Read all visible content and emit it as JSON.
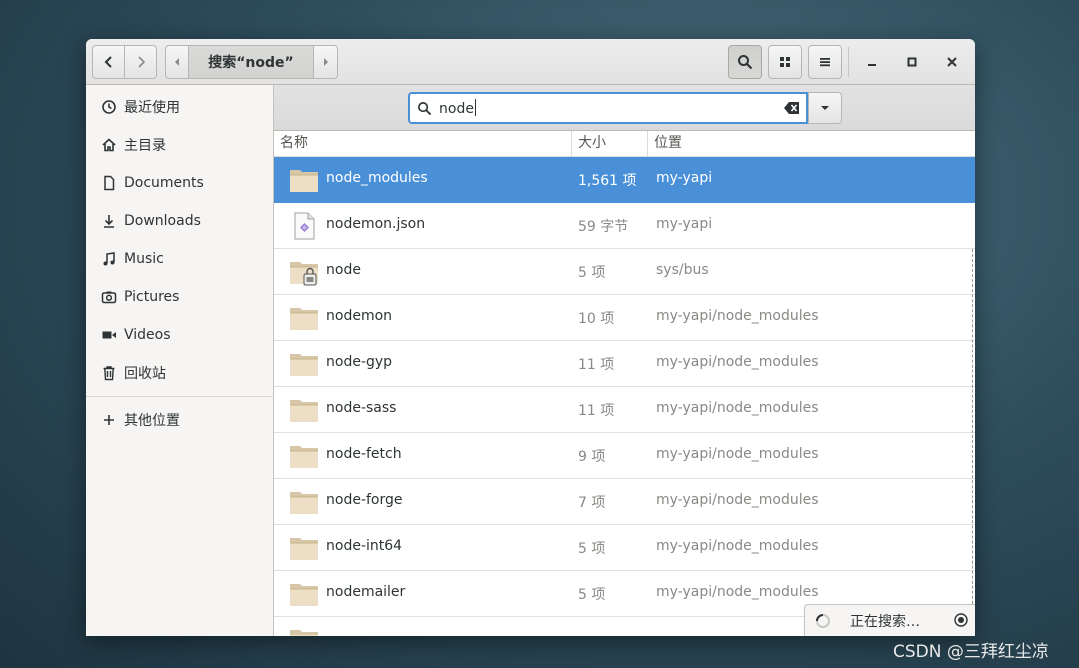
{
  "header": {
    "path_label": "搜索“node”"
  },
  "sidebar": {
    "items": [
      {
        "label": "最近使用",
        "icon": "recent-icon"
      },
      {
        "label": "主目录",
        "icon": "home-icon"
      },
      {
        "label": "Documents",
        "icon": "document-icon"
      },
      {
        "label": "Downloads",
        "icon": "download-icon"
      },
      {
        "label": "Music",
        "icon": "music-icon"
      },
      {
        "label": "Pictures",
        "icon": "camera-icon"
      },
      {
        "label": "Videos",
        "icon": "video-icon"
      },
      {
        "label": "回收站",
        "icon": "trash-icon"
      },
      {
        "label": "其他位置",
        "icon": "plus-icon"
      }
    ]
  },
  "search": {
    "value": "node"
  },
  "columns": {
    "name": "名称",
    "size": "大小",
    "location": "位置"
  },
  "rows": [
    {
      "name": "node_modules",
      "size": "1,561 项",
      "location": "my-yapi",
      "icon": "folder-icon",
      "selected": true
    },
    {
      "name": "nodemon.json",
      "size": "59 字节",
      "location": "my-yapi",
      "icon": "json-file-icon"
    },
    {
      "name": "node",
      "size": "5 项",
      "location": "sys/bus",
      "icon": "locked-folder-icon"
    },
    {
      "name": "nodemon",
      "size": "10 项",
      "location": "my-yapi/node_modules",
      "icon": "folder-icon"
    },
    {
      "name": "node-gyp",
      "size": "11 项",
      "location": "my-yapi/node_modules",
      "icon": "folder-icon"
    },
    {
      "name": "node-sass",
      "size": "11 项",
      "location": "my-yapi/node_modules",
      "icon": "folder-icon"
    },
    {
      "name": "node-fetch",
      "size": "9 项",
      "location": "my-yapi/node_modules",
      "icon": "folder-icon"
    },
    {
      "name": "node-forge",
      "size": "7 项",
      "location": "my-yapi/node_modules",
      "icon": "folder-icon"
    },
    {
      "name": "node-int64",
      "size": "5 项",
      "location": "my-yapi/node_modules",
      "icon": "folder-icon"
    },
    {
      "name": "nodemailer",
      "size": "5 项",
      "location": "my-yapi/node_modules",
      "icon": "folder-icon"
    }
  ],
  "status": {
    "text": "正在搜索…"
  },
  "watermark": "CSDN @三拜红尘凉",
  "colors": {
    "selection": "#4a90d9",
    "folder": "#e9dcc4",
    "sidebar_bg": "#f6f5f4"
  }
}
